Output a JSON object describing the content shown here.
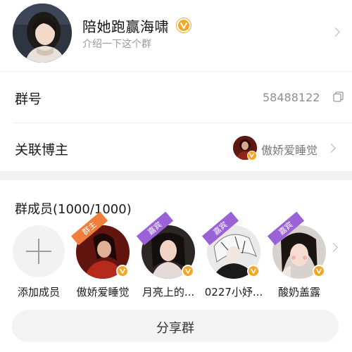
{
  "group": {
    "name": "陪她跑赢海啸",
    "description": "介绍一下这个群",
    "verified_badge": "verified-v-badge"
  },
  "group_number": {
    "label": "群号",
    "value": "58488122",
    "icon": "copy-icon"
  },
  "linked_blogger": {
    "label": "关联博主",
    "name": "傲娇爱睡觉"
  },
  "members": {
    "title": "群成员(1000/1000)",
    "add_label": "添加成员",
    "list": [
      {
        "name": "傲娇爱睡觉",
        "role": "群主",
        "verified": true
      },
      {
        "name": "月亮上的...",
        "role": "嘉宾",
        "verified": true
      },
      {
        "name": "0227小妤...",
        "role": "嘉宾",
        "verified": true
      },
      {
        "name": "酸奶盖露",
        "role": "嘉宾",
        "verified": true
      }
    ]
  },
  "share_button": {
    "label": "分享群"
  },
  "colors": {
    "badge": "#f5a623",
    "owner_ribbon": "#ef7d3b",
    "guest_ribbon": "#9b62d8",
    "secondary_text": "#8f8f8f"
  }
}
